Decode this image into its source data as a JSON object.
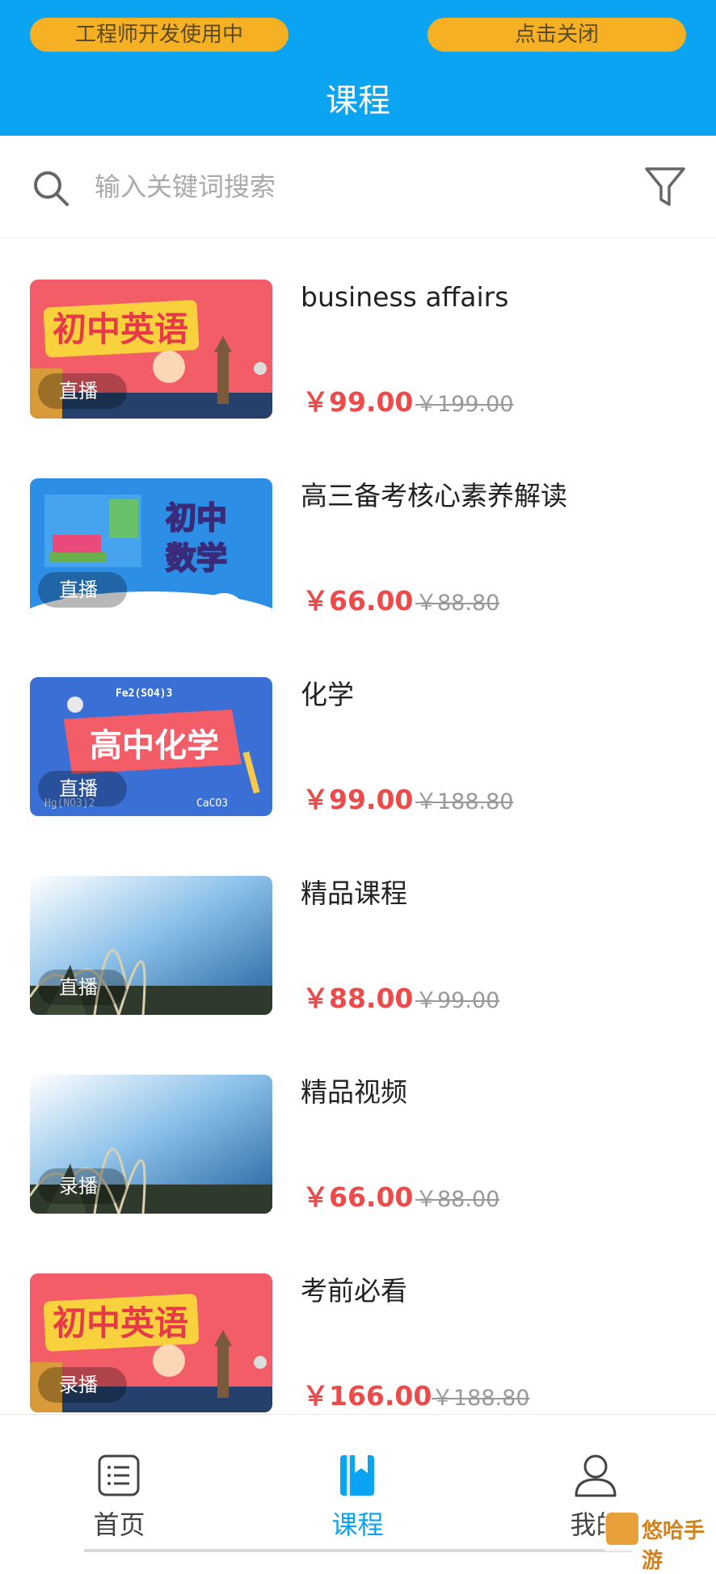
{
  "header": {
    "dev_badge": "工程师开发使用中",
    "close_button": "点击关闭",
    "title": "课程",
    "color": "#0aa4f2"
  },
  "search": {
    "placeholder": "输入关键词搜索"
  },
  "courses": [
    {
      "name": "business affairs",
      "badge": "直播",
      "price": "￥99.00",
      "original_price": "￥199.00",
      "thumb": "junior-english"
    },
    {
      "name": "高三备考核心素养解读",
      "badge": "直播",
      "price": "￥66.00",
      "original_price": "￥88.80",
      "thumb": "junior-math"
    },
    {
      "name": "化学",
      "badge": "直播",
      "price": "￥99.00",
      "original_price": "￥188.80",
      "thumb": "senior-chemistry"
    },
    {
      "name": "精品课程",
      "badge": "直播",
      "price": "￥88.00",
      "original_price": "￥99.00",
      "thumb": "reed-landscape"
    },
    {
      "name": "精品视频",
      "badge": "录播",
      "price": "￥66.00",
      "original_price": "￥88.00",
      "thumb": "reed-landscape"
    },
    {
      "name": "考前必看",
      "badge": "录播",
      "price": "￥166.00",
      "original_price": "￥188.80",
      "thumb": "junior-english"
    }
  ],
  "thumbnails": {
    "english_title": "初中英语",
    "math_title_1": "初中",
    "math_title_2": "数学",
    "chem_title": "高中化学",
    "chem_formula_1": "Fe2(SO4)3",
    "chem_formula_2": "Hg(NO3)2",
    "chem_formula_3": "CaCO3"
  },
  "tabbar": {
    "tabs": [
      {
        "label": "首页",
        "icon": "list-icon"
      },
      {
        "label": "课程",
        "icon": "book-icon"
      },
      {
        "label": "我的",
        "icon": "user-icon"
      }
    ],
    "active_color": "#0aa4f2"
  },
  "watermark": "悠哈手游"
}
